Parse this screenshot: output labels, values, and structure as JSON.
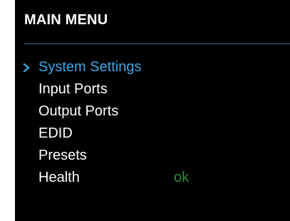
{
  "header": {
    "title": "MAIN MENU"
  },
  "menu": {
    "selected_index": 0,
    "items": [
      {
        "label": "System Settings"
      },
      {
        "label": "Input Ports"
      },
      {
        "label": "Output Ports"
      },
      {
        "label": "EDID"
      },
      {
        "label": "Presets"
      },
      {
        "label": "Health",
        "status": "ok"
      }
    ]
  },
  "colors": {
    "background": "#000000",
    "text": "#ffffff",
    "selected": "#3fa7e4",
    "status_ok": "#2e8b3a",
    "divider": "#4a6a80"
  },
  "icons": {
    "cursor": "chevron-right-icon"
  }
}
